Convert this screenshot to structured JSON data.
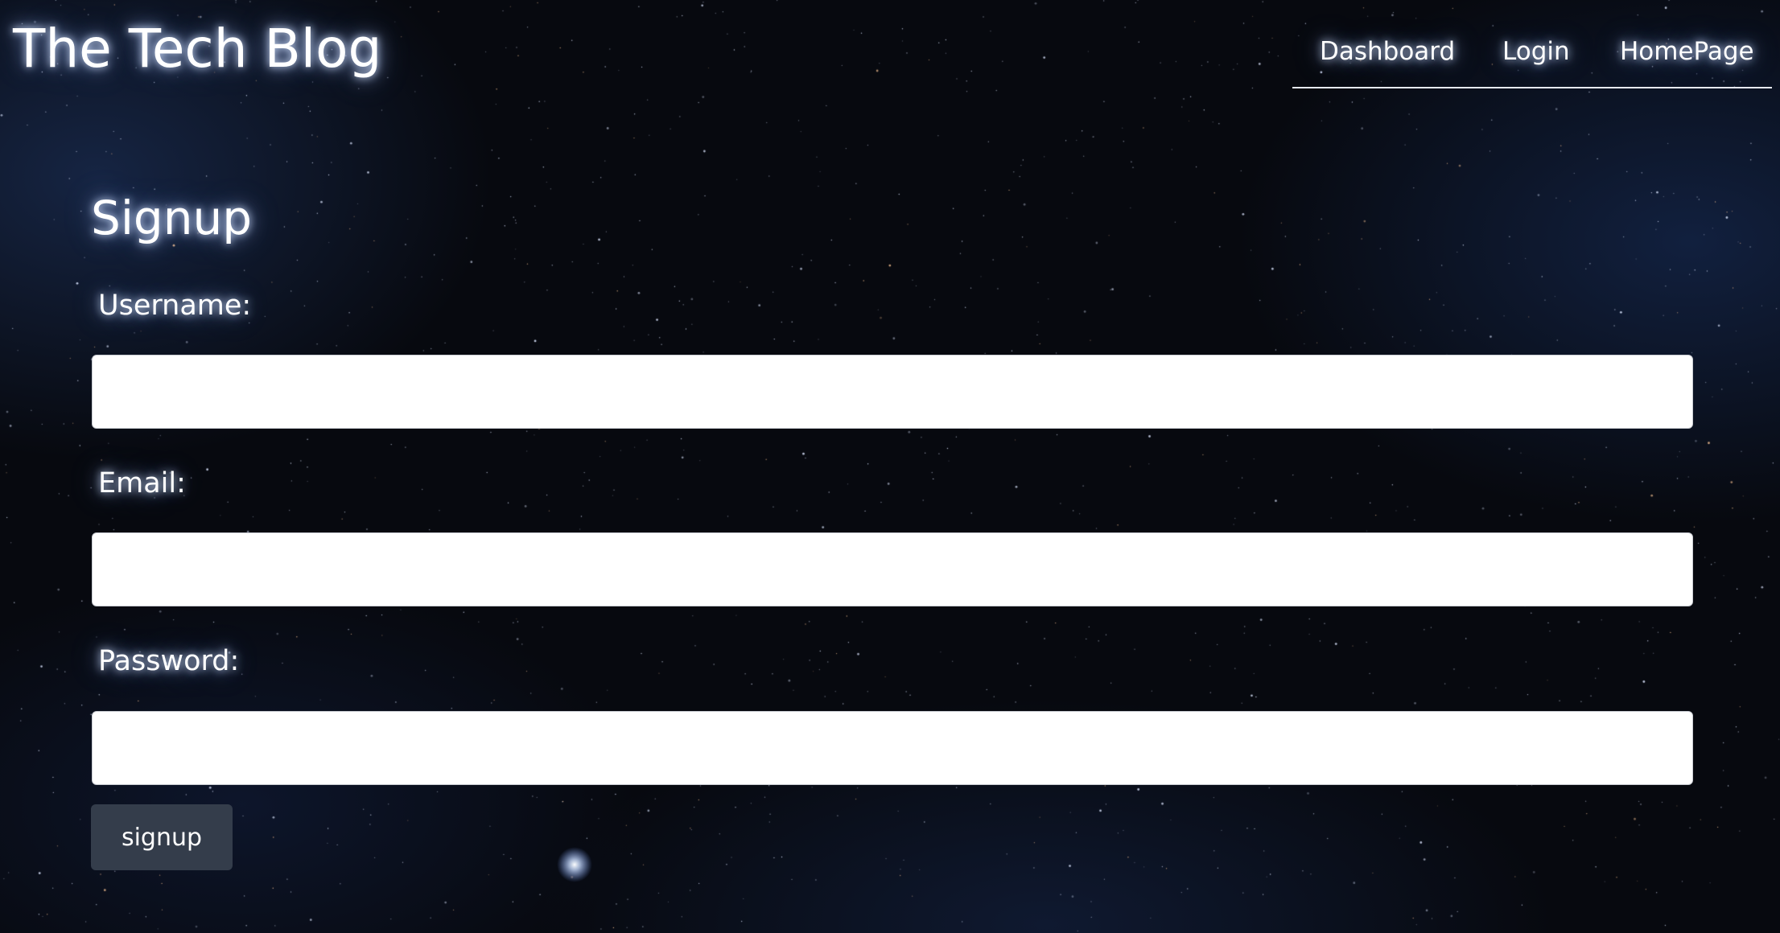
{
  "header": {
    "title": "The Tech Blog",
    "nav": [
      {
        "label": "Dashboard"
      },
      {
        "label": "Login"
      },
      {
        "label": "HomePage"
      }
    ]
  },
  "form": {
    "heading": "Signup",
    "fields": [
      {
        "label": "Username:",
        "value": "",
        "placeholder": ""
      },
      {
        "label": "Email:",
        "value": "",
        "placeholder": ""
      },
      {
        "label": "Password:",
        "value": "",
        "placeholder": ""
      }
    ],
    "submit_label": "signup"
  },
  "colors": {
    "background": "#07090f",
    "button": "#343d4b",
    "glow": "#c8d8ff",
    "input": "#ffffff"
  }
}
